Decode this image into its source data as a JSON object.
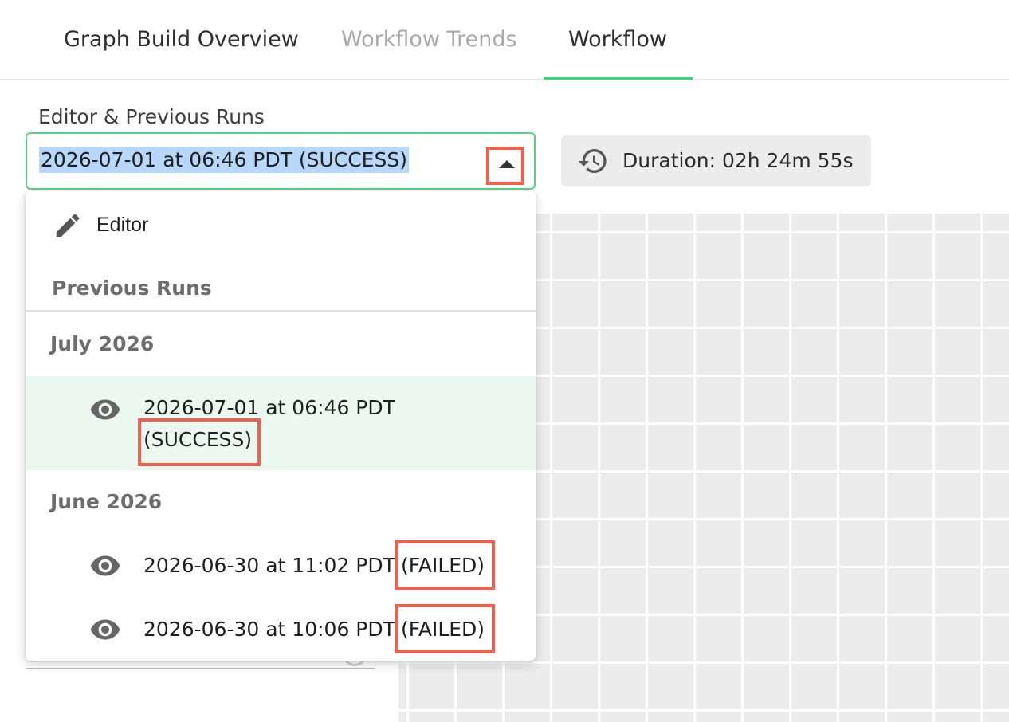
{
  "tabs": [
    {
      "label": "Graph Build Overview",
      "state": "default"
    },
    {
      "label": "Workflow Trends",
      "state": "disabled"
    },
    {
      "label": "Workflow",
      "state": "active"
    }
  ],
  "selector": {
    "label": "Editor & Previous Runs",
    "value": "2026-07-01 at 06:46 PDT (SUCCESS)"
  },
  "duration": {
    "icon": "history-icon",
    "text": "Duration: 02h 24m 55s"
  },
  "dropdown": {
    "editor": {
      "icon": "pencil-icon",
      "label": "Editor"
    },
    "header": "Previous Runs",
    "groups": [
      {
        "label": "July 2026",
        "runs": [
          {
            "icon": "eye-icon",
            "time": "2026-07-01 at 06:46 PDT",
            "status": "(SUCCESS)",
            "selected": true
          }
        ]
      },
      {
        "label": "June 2026",
        "runs": [
          {
            "icon": "eye-icon",
            "time": "2026-06-30 at 11:02 PDT",
            "status": "(FAILED)",
            "selected": false
          },
          {
            "icon": "eye-icon",
            "time": "2026-06-30 at 10:06 PDT",
            "status": "(FAILED)",
            "selected": false
          }
        ]
      }
    ]
  },
  "colors": {
    "accent": "#3cd27f",
    "highlight": "#f0604f",
    "selection": "#b8d8fb",
    "selected_row": "#eaf8ef"
  }
}
